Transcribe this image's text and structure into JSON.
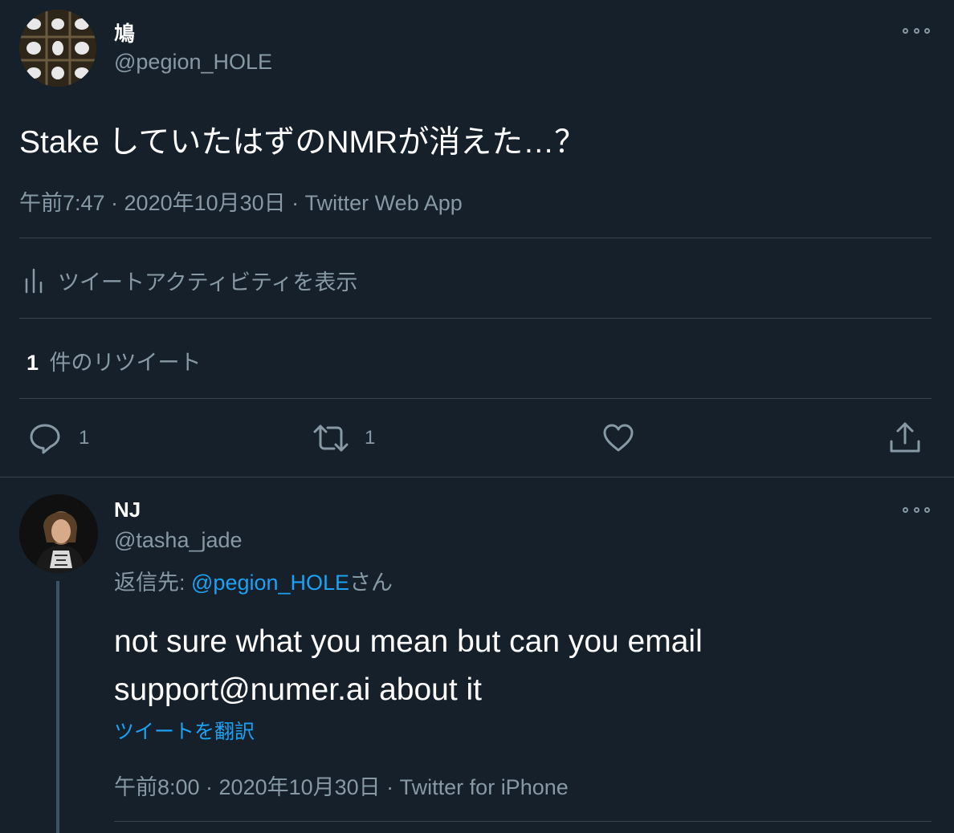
{
  "tweet": {
    "display_name": "鳩",
    "handle": "@pegion_HOLE",
    "text": "Stake していたはずのNMRが消えた…？",
    "meta": "午前7:47 · 2020年10月30日 · Twitter Web App",
    "activity_label": "ツイートアクティビティを表示",
    "retweets_count": "1",
    "retweets_label": "件のリツイート",
    "actions": {
      "reply_count": "1",
      "retweet_count": "1"
    }
  },
  "reply": {
    "display_name": "NJ",
    "handle": "@tasha_jade",
    "replying_prefix": "返信先: ",
    "replying_handle": "@pegion_HOLE",
    "replying_suffix": "さん",
    "text_line1": "not sure what you mean but can you email",
    "text_line2": "support@numer.ai about it",
    "translate_label": "ツイートを翻訳",
    "meta": "午前8:00 · 2020年10月30日 · Twitter for iPhone"
  },
  "colors": {
    "background": "#15202b",
    "text": "#ffffff",
    "muted": "#8899a6",
    "accent": "#1da1f2",
    "divider": "#38444d"
  },
  "icons": [
    "more-icon",
    "activity-chart-icon",
    "reply-icon",
    "retweet-icon",
    "like-icon",
    "share-icon"
  ]
}
